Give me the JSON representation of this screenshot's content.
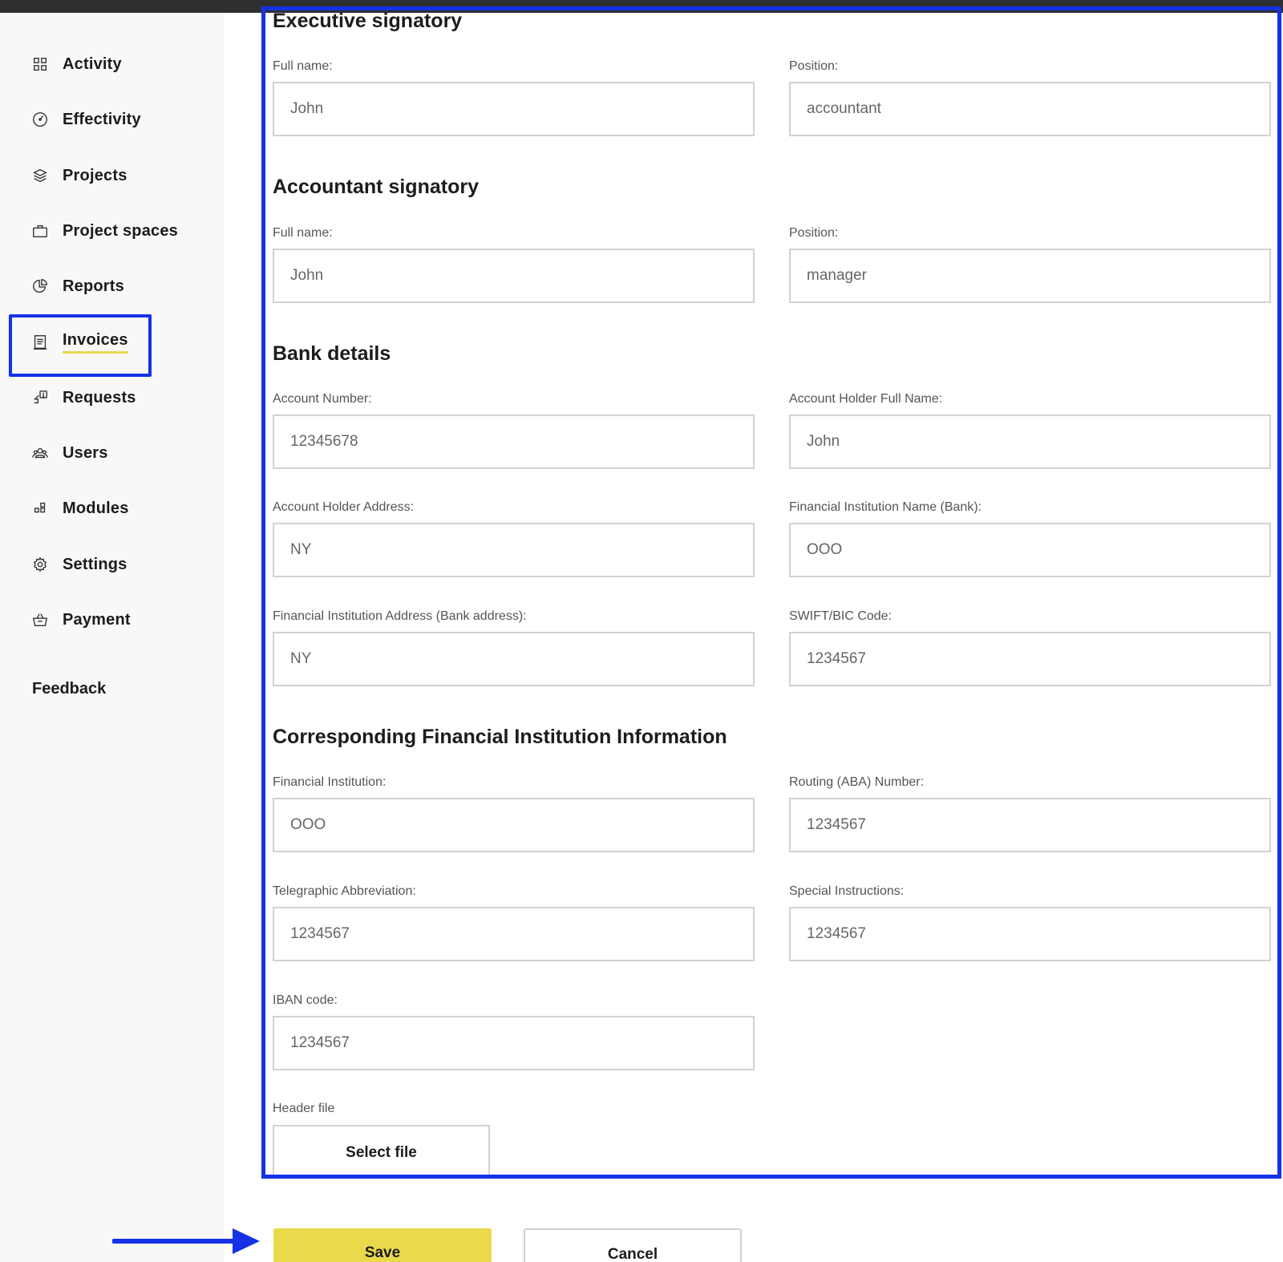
{
  "sidebar": {
    "items": [
      {
        "label": "Activity",
        "icon": "grid-icon"
      },
      {
        "label": "Effectivity",
        "icon": "gauge-icon"
      },
      {
        "label": "Projects",
        "icon": "layers-icon"
      },
      {
        "label": "Project spaces",
        "icon": "briefcase-icon"
      },
      {
        "label": "Reports",
        "icon": "pie-chart-icon"
      },
      {
        "label": "Invoices",
        "icon": "receipt-icon",
        "active": true
      },
      {
        "label": "Requests",
        "icon": "request-icon"
      },
      {
        "label": "Users",
        "icon": "users-icon"
      },
      {
        "label": "Modules",
        "icon": "modules-icon"
      },
      {
        "label": "Settings",
        "icon": "gear-icon"
      },
      {
        "label": "Payment",
        "icon": "basket-icon"
      }
    ],
    "feedback": "Feedback"
  },
  "form": {
    "executive": {
      "title": "Executive signatory",
      "full_name_label": "Full name:",
      "full_name_value": "John",
      "position_label": "Position:",
      "position_value": "accountant"
    },
    "accountant": {
      "title": "Accountant signatory",
      "full_name_label": "Full name:",
      "full_name_value": "John",
      "position_label": "Position:",
      "position_value": "manager"
    },
    "bank": {
      "title": "Bank details",
      "account_number_label": "Account Number:",
      "account_number_value": "12345678",
      "holder_name_label": "Account Holder Full Name:",
      "holder_name_value": "John",
      "holder_address_label": "Account Holder Address:",
      "holder_address_value": "NY",
      "institution_name_label": "Financial Institution Name (Bank):",
      "institution_name_value": "OOO",
      "institution_address_label": "Financial Institution Address (Bank address):",
      "institution_address_value": "NY",
      "swift_label": "SWIFT/BIC Code:",
      "swift_value": "1234567"
    },
    "corresponding": {
      "title": "Corresponding Financial Institution Information",
      "institution_label": "Financial Institution:",
      "institution_value": "OOO",
      "routing_label": "Routing (ABA) Number:",
      "routing_value": "1234567",
      "telegraphic_label": "Telegraphic Abbreviation:",
      "telegraphic_value": "1234567",
      "special_label": "Special Instructions:",
      "special_value": "1234567",
      "iban_label": "IBAN code:",
      "iban_value": "1234567"
    },
    "header_file": {
      "label": "Header file",
      "button": "Select file"
    }
  },
  "actions": {
    "save": "Save",
    "cancel": "Cancel"
  },
  "colors": {
    "highlight": "#1532e6",
    "accent": "#ebd94c",
    "topbar": "#2e2f31"
  }
}
